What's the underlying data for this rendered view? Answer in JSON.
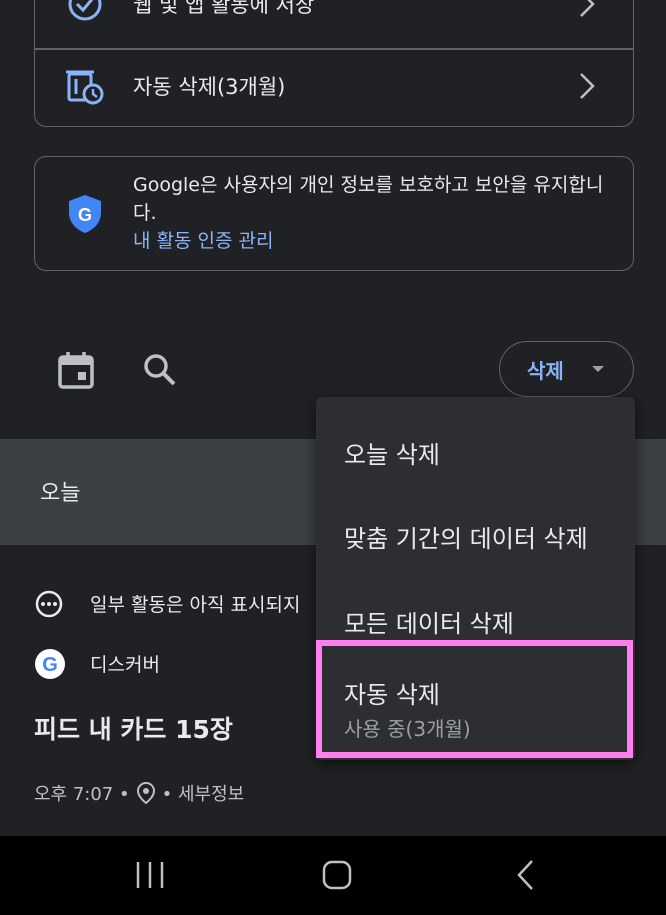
{
  "settings": {
    "web_app_activity_label": "웹 및 앱 활동에 저장",
    "auto_delete_label": "자동 삭제(3개월)"
  },
  "info_card": {
    "text": "Google은 사용자의 개인 정보를 보호하고 보안을 유지합니다.",
    "link": "내 활동 인증 관리"
  },
  "toolbar": {
    "delete_button": "삭제"
  },
  "timeline": {
    "today": "오늘",
    "notice": "일부 활동은 아직 표시되지",
    "source": "디스커버",
    "title": "피드 내 카드 15장",
    "meta_time": "오후 7:07 •",
    "meta_details": "• 세부정보"
  },
  "menu": {
    "items": [
      {
        "label": "오늘 삭제"
      },
      {
        "label": "맞춤 기간의 데이터 삭제"
      },
      {
        "label": "모든 데이터 삭제"
      },
      {
        "label": "자동 삭제",
        "sub": "사용 중(3개월)"
      }
    ]
  },
  "colors": {
    "background": "#202124",
    "accent_blue": "#8ab4f8",
    "highlight": "#ff7ff0"
  }
}
